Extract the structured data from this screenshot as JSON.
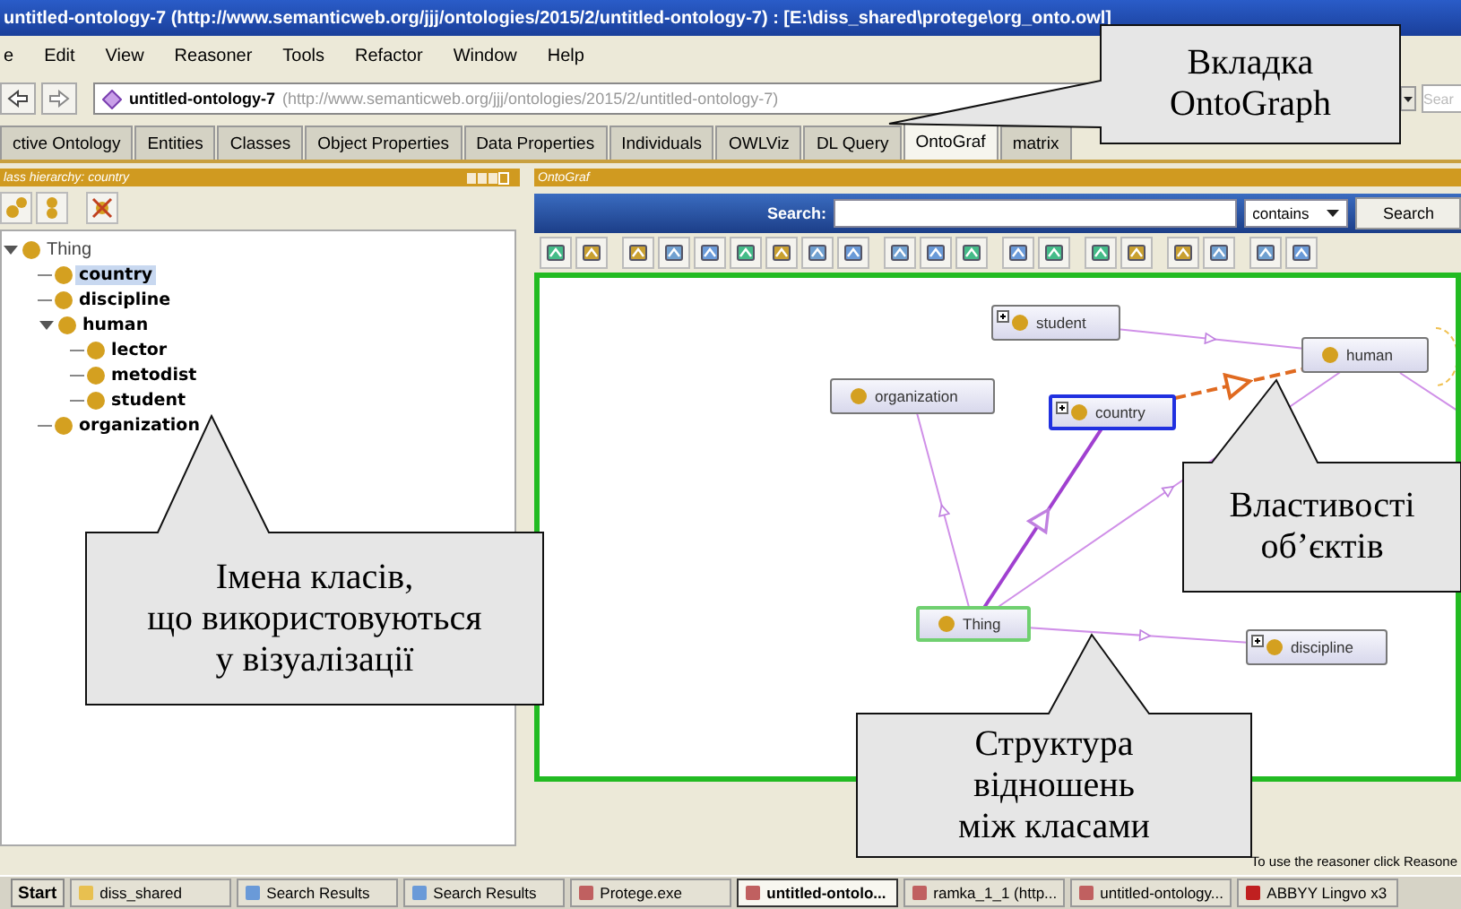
{
  "window": {
    "title": "untitled-ontology-7 (http://www.semanticweb.org/jjj/ontologies/2015/2/untitled-ontology-7) : [E:\\diss_shared\\protege\\org_onto.owl]"
  },
  "menu": [
    "e",
    "Edit",
    "View",
    "Reasoner",
    "Tools",
    "Refactor",
    "Window",
    "Help"
  ],
  "address_bar": {
    "ontology": "untitled-ontology-7",
    "iri": "(http://www.semanticweb.org/jjj/ontologies/2015/2/untitled-ontology-7)",
    "search_placeholder": "Sear"
  },
  "tabs": [
    {
      "label": "ctive Ontology",
      "selected": false
    },
    {
      "label": "Entities",
      "selected": false
    },
    {
      "label": "Classes",
      "selected": false
    },
    {
      "label": "Object Properties",
      "selected": false
    },
    {
      "label": "Data Properties",
      "selected": false
    },
    {
      "label": "Individuals",
      "selected": false
    },
    {
      "label": "OWLViz",
      "selected": false
    },
    {
      "label": "DL Query",
      "selected": false
    },
    {
      "label": "OntoGraf",
      "selected": true
    },
    {
      "label": "matrix",
      "selected": false
    }
  ],
  "class_panel": {
    "title": "lass hierarchy: country",
    "tree": [
      {
        "name": "Thing",
        "kind": "builtin",
        "selected": false,
        "expanded": true,
        "children": [
          {
            "name": "country",
            "kind": "class",
            "selected": true
          },
          {
            "name": "discipline",
            "kind": "class",
            "selected": false
          },
          {
            "name": "human",
            "kind": "class",
            "selected": false,
            "expanded": true,
            "children": [
              {
                "name": "lector",
                "kind": "class",
                "selected": false
              },
              {
                "name": "metodist",
                "kind": "class",
                "selected": false
              },
              {
                "name": "student",
                "kind": "class",
                "selected": false
              }
            ]
          },
          {
            "name": "organization",
            "kind": "class",
            "selected": false
          }
        ]
      }
    ]
  },
  "ontograf": {
    "title": "OntoGraf",
    "search_label": "Search:",
    "match_mode": "contains",
    "search_button": "Search",
    "nodes": [
      {
        "name": "student",
        "kind": "class",
        "expandable": true,
        "selected": false
      },
      {
        "name": "human",
        "kind": "class",
        "expandable": false,
        "selected": false
      },
      {
        "name": "organization",
        "kind": "class",
        "expandable": false,
        "selected": false
      },
      {
        "name": "country",
        "kind": "class",
        "expandable": true,
        "selected": true
      },
      {
        "name": "Thing",
        "kind": "root",
        "expandable": false,
        "selected": false
      },
      {
        "name": "discipline",
        "kind": "class",
        "expandable": true,
        "selected": false
      }
    ],
    "edges": [
      {
        "kind": "subclass",
        "highlighted": false
      },
      {
        "kind": "subclass",
        "highlighted": false
      },
      {
        "kind": "subclass",
        "highlighted": true
      },
      {
        "kind": "subclass",
        "highlighted": false
      },
      {
        "kind": "subclass",
        "highlighted": false
      },
      {
        "kind": "property",
        "highlighted": false
      }
    ]
  },
  "status_bar": "To use the reasoner click Reasone",
  "taskbar": {
    "start": "Start",
    "items": [
      {
        "label": "diss_shared",
        "kind": "folder",
        "selected": false
      },
      {
        "label": "Search Results",
        "kind": "search",
        "selected": false
      },
      {
        "label": "Search Results",
        "kind": "search",
        "selected": false
      },
      {
        "label": "Protege.exe",
        "kind": "app",
        "selected": false
      },
      {
        "label": "untitled-ontolo...",
        "kind": "app",
        "selected": true
      },
      {
        "label": "ramka_1_1 (http...",
        "kind": "app",
        "selected": false
      },
      {
        "label": "untitled-ontology...",
        "kind": "app",
        "selected": false
      },
      {
        "label": "ABBYY Lingvo x3",
        "kind": "book",
        "selected": false
      }
    ]
  },
  "callouts": [
    {
      "lines": [
        "Вкладка",
        "OntoGraph"
      ]
    },
    {
      "lines": [
        "Імена класів,",
        "що використовуються",
        "у візуалізації"
      ]
    },
    {
      "lines": [
        "Властивості",
        "об’єктів"
      ]
    },
    {
      "lines": [
        "Структура",
        "відношень",
        "між класами"
      ]
    }
  ]
}
